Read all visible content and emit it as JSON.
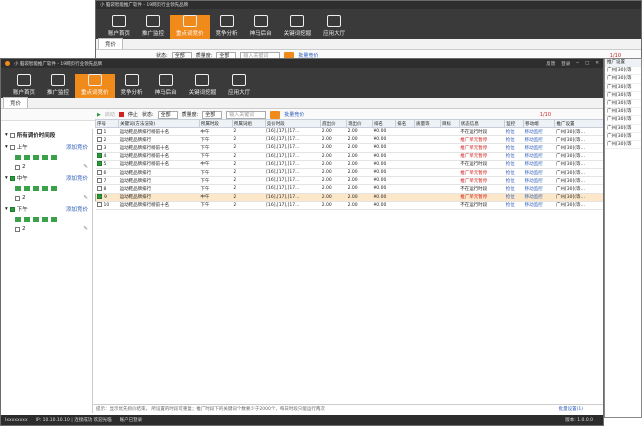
{
  "app": {
    "title": "小 脑袋智能推广软件 - 19网页行业领先品牌",
    "ctrls": [
      "反馈",
      "登录",
      "─",
      "□",
      "✕"
    ],
    "status_user": "Ixxxxxxxx",
    "status_msg": "IP: 10.10.10.10 | 连接成功 欢迎光临",
    "status_shop": "账户已登录",
    "version": "版本: 1.0.0.0"
  },
  "toolbar": [
    {
      "label": "账户首页",
      "icon": "home-icon"
    },
    {
      "label": "推广监控",
      "icon": "pulse-icon"
    },
    {
      "label": "重点词竞价",
      "icon": "bid-icon"
    },
    {
      "label": "竞争分析",
      "icon": "chart-icon"
    },
    {
      "label": "神马后台",
      "icon": "owl-icon"
    },
    {
      "label": "关键词挖掘",
      "icon": "magnifier-icon"
    },
    {
      "label": "应用大厅",
      "icon": "grid-icon"
    }
  ],
  "tab": "竞价",
  "filter": {
    "start": "启动",
    "stop": "停止",
    "state_label": "状态:",
    "state_val": "全部",
    "qty_label": "质量度:",
    "qty_val": "全部",
    "search_ph": "输入关键词",
    "batch": "批量竞价",
    "page": "1/10"
  },
  "sidebar": {
    "root": "所有调价时间段",
    "groups": [
      {
        "label": "上午",
        "link": "添加竞价"
      },
      {
        "label": "中午",
        "link": "添加竞价"
      },
      {
        "label": "下午",
        "link": "添加竞价"
      }
    ],
    "counts": [
      "2",
      "2",
      "2"
    ]
  },
  "table": {
    "headers": [
      "序号",
      "关键词(方法渲染)",
      "所属时段",
      "所属词组",
      "竞价时段",
      "底出价",
      "现出价",
      "排名",
      "排名",
      "质量等",
      "目标",
      "状态信息",
      "监控",
      "移动端",
      "推广设置"
    ],
    "rows": [
      [
        "1",
        "运动鞋品牌排行榜前十名",
        "中午",
        "2",
        "[16],[17],[17…",
        "2.00",
        "2.00",
        "¥0.00",
        "",
        "",
        "",
        "不在运行时段",
        "抢位",
        "移动监控",
        "广州[30](等…"
      ],
      [
        "2",
        "运动鞋品牌排行",
        "下午",
        "2",
        "[16],[17],[17…",
        "2.00",
        "2.00",
        "¥0.00",
        "",
        "",
        "",
        "推广单元暂停",
        "抢位",
        "移动监控",
        "广州[30](等…"
      ],
      [
        "3",
        "运动鞋品牌排行榜前十名",
        "下午",
        "2",
        "[16],[17],[17…",
        "2.00",
        "2.00",
        "¥0.00",
        "",
        "",
        "",
        "推广单元暂停",
        "抢位",
        "移动监控",
        "广州[30](等…"
      ],
      [
        "4",
        "运动鞋品牌排行榜前十名",
        "下午",
        "2",
        "[16],[17],[17…",
        "2.00",
        "2.00",
        "¥0.00",
        "",
        "",
        "",
        "推广单元暂停",
        "抢位",
        "移动监控",
        "广州[30](等…"
      ],
      [
        "5",
        "运动鞋品牌排行榜前十名",
        "中午",
        "2",
        "[16],[17],[17…",
        "2.00",
        "2.00",
        "¥0.00",
        "",
        "",
        "",
        "不在运行时段",
        "抢位",
        "移动监控",
        "广州[30](等…"
      ],
      [
        "6",
        "运动鞋品牌排行",
        "下午",
        "2",
        "[16],[17],[17…",
        "2.00",
        "2.00",
        "¥0.00",
        "",
        "",
        "",
        "推广单元暂停",
        "抢位",
        "移动监控",
        "广州[30](等…"
      ],
      [
        "7",
        "运动鞋品牌排行",
        "下午",
        "2",
        "[16],[17],[17…",
        "2.00",
        "2.00",
        "¥0.00",
        "",
        "",
        "",
        "推广单元暂停",
        "抢位",
        "移动监控",
        "广州[30](等…"
      ],
      [
        "8",
        "运动鞋品牌排行",
        "下午",
        "2",
        "[16],[17],[17…",
        "2.00",
        "2.00",
        "¥0.00",
        "",
        "",
        "",
        "不在运行时段",
        "抢位",
        "移动监控",
        "广州[30](等…"
      ],
      [
        "9",
        "运动鞋品牌排行",
        "中午",
        "2",
        "[16],[17],[17…",
        "2.00",
        "2.00",
        "¥0.00",
        "",
        "",
        "",
        "推广单元暂停",
        "抢位",
        "移动监控",
        "广州[30](等…"
      ],
      [
        "10",
        "运动鞋品牌排行榜前十名",
        "下午",
        "2",
        "[16],[17],[17…",
        "2.00",
        "2.00",
        "¥0.00",
        "",
        "",
        "",
        "不在运行时段",
        "抢位",
        "移动监控",
        "广州[30](等…"
      ]
    ]
  },
  "tip": "提示：显示优先抓价结束， 所设置的时段可重复；推广时段下的关键词个数要少于2000个，每日时段只能运行两次",
  "tip_link": "批量设置(1)",
  "right_panel": {
    "title": "推广设置",
    "items": [
      "广州[30](等",
      "广州[30](等",
      "广州[30](等",
      "广州[30](等",
      "广州[30](等",
      "广州[30](等",
      "广州[30](等",
      "广州[30](等",
      "广州[30](等",
      "广州[30](等"
    ]
  }
}
